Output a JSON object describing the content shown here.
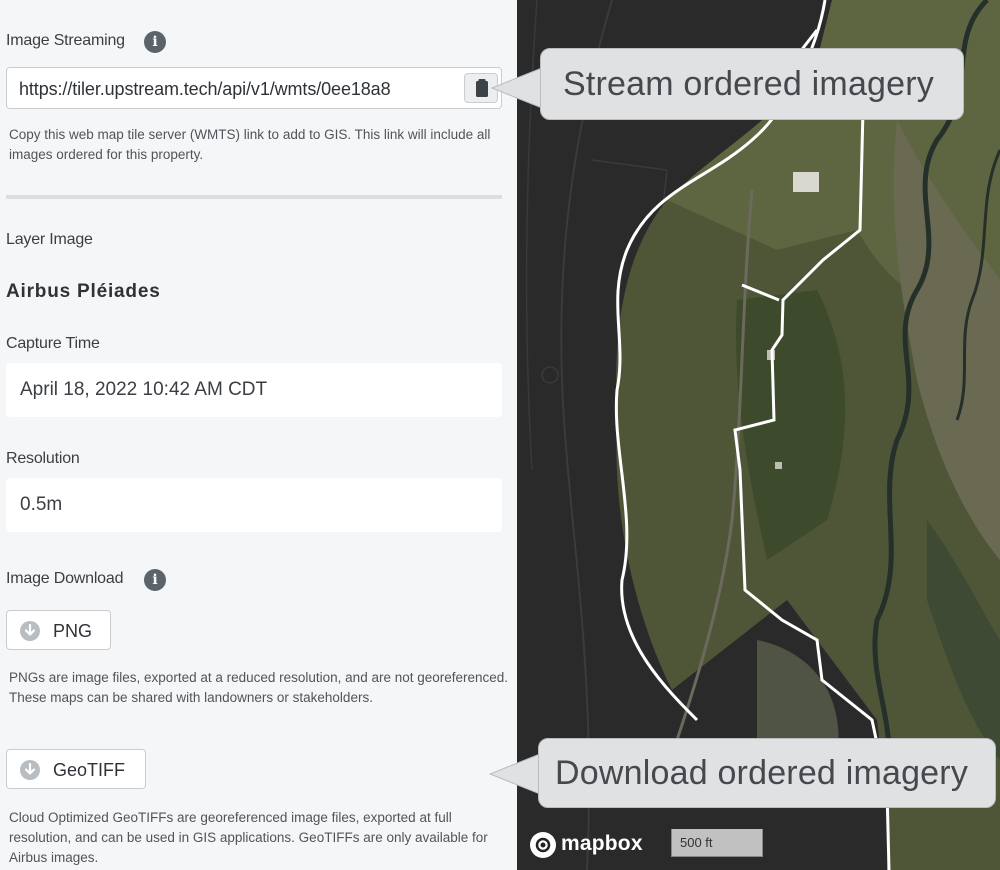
{
  "image_streaming": {
    "label": "Image Streaming",
    "url": "https://tiler.upstream.tech/api/v1/wmts/0ee18a8",
    "help": "Copy this web map tile server (WMTS) link to add to GIS. This link will include all images ordered for this property."
  },
  "layer_image": {
    "label": "Layer Image",
    "value": "Airbus Pléiades"
  },
  "capture_time": {
    "label": "Capture Time",
    "value": "April 18, 2022 10:42 AM CDT"
  },
  "resolution": {
    "label": "Resolution",
    "value": "0.5m"
  },
  "image_download": {
    "label": "Image Download",
    "png_button": "PNG",
    "png_help": "PNGs are image files, exported at a reduced resolution, and are not georeferenced. These maps can be shared with landowners or stakeholders.",
    "geotiff_button": "GeoTIFF",
    "geotiff_help": "Cloud Optimized GeoTIFFs are georeferenced image files, exported at full resolution, and can be used in GIS applications. GeoTIFFs are only available for Airbus images."
  },
  "map": {
    "logo": "mapbox",
    "scale": "500 ft"
  },
  "callouts": {
    "stream": "Stream ordered imagery",
    "download": "Download ordered imagery"
  },
  "icons": {
    "info": "info-icon",
    "copy": "clipboard-icon",
    "download": "download-icon"
  }
}
